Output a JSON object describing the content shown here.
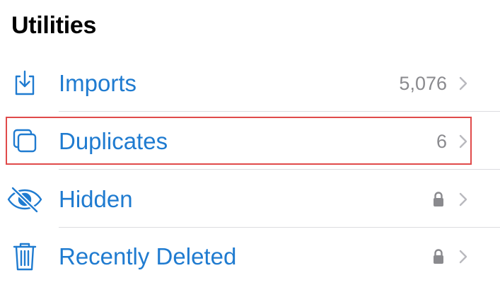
{
  "section": {
    "title": "Utilities"
  },
  "rows": [
    {
      "label": "Imports",
      "count": "5,076",
      "icon": "import-tray-icon",
      "locked": false
    },
    {
      "label": "Duplicates",
      "count": "6",
      "icon": "duplicates-icon",
      "locked": false,
      "highlighted": true
    },
    {
      "label": "Hidden",
      "count": "",
      "icon": "eye-slash-icon",
      "locked": true
    },
    {
      "label": "Recently Deleted",
      "count": "",
      "icon": "trash-icon",
      "locked": true
    }
  ],
  "colors": {
    "accent": "#1f7bd0",
    "secondary_text": "#8a8a8e",
    "highlight_border": "#e04a4a",
    "separator": "#dcdce0"
  }
}
